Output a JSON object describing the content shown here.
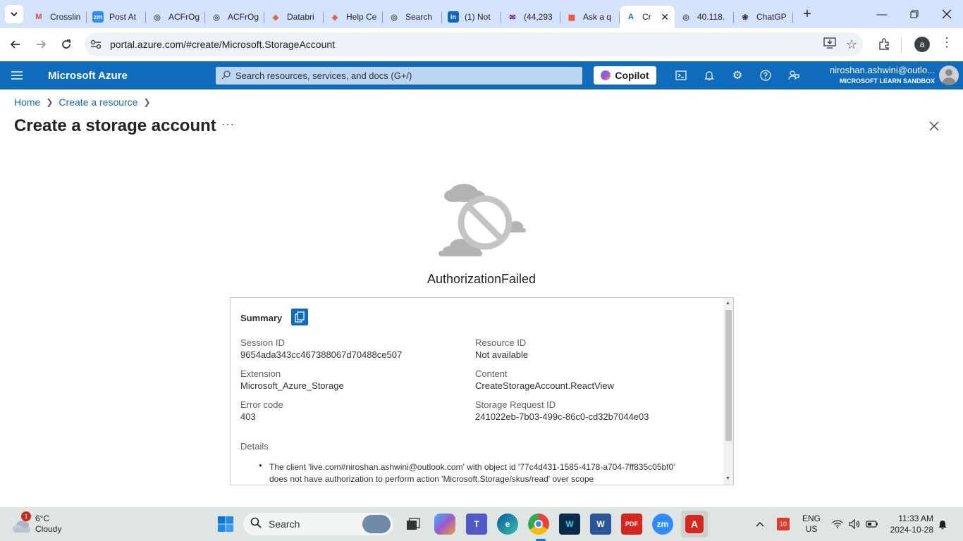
{
  "browser": {
    "tabs": [
      {
        "label": "Crosslin",
        "icon": "gmail-icon",
        "active": false
      },
      {
        "label": "Post At",
        "icon": "zoom-icon",
        "active": false
      },
      {
        "label": "ACFrOg",
        "icon": "globe-icon",
        "active": false
      },
      {
        "label": "ACFrOg",
        "icon": "globe-icon",
        "active": false
      },
      {
        "label": "Databri",
        "icon": "databricks-icon",
        "active": false
      },
      {
        "label": "Help Ce",
        "icon": "databricks-icon",
        "active": false
      },
      {
        "label": "Search",
        "icon": "globe-icon",
        "active": false
      },
      {
        "label": "(1) Not",
        "icon": "linkedin-icon",
        "active": false
      },
      {
        "label": "(44,293",
        "icon": "mail-icon",
        "active": false
      },
      {
        "label": "Ask a q",
        "icon": "microsoft-icon",
        "active": false
      },
      {
        "label": "Cr",
        "icon": "azure-icon",
        "active": true
      },
      {
        "label": "40.118.",
        "icon": "globe-icon",
        "active": false
      },
      {
        "label": "ChatGP",
        "icon": "chatgpt-icon",
        "active": false
      }
    ],
    "url": "portal.azure.com/#create/Microsoft.StorageAccount",
    "profile_initial": "a"
  },
  "azure": {
    "brand": "Microsoft Azure",
    "search_placeholder": "Search resources, services, and docs (G+/)",
    "copilot_label": "Copilot",
    "account_name": "niroshan.ashwini@outlo...",
    "account_org": "MICROSOFT LEARN SANDBOX"
  },
  "breadcrumb": [
    "Home",
    "Create a resource"
  ],
  "page_title": "Create a storage account",
  "page_more": "···",
  "error": {
    "title": "AuthorizationFailed",
    "summary_label": "Summary",
    "fields": {
      "session_id_label": "Session ID",
      "session_id": "9654ada343cc467388067d70488ce507",
      "resource_id_label": "Resource ID",
      "resource_id": "Not available",
      "extension_label": "Extension",
      "extension": "Microsoft_Azure_Storage",
      "content_label": "Content",
      "content": "CreateStorageAccount.ReactView",
      "error_code_label": "Error code",
      "error_code": "403",
      "storage_request_id_label": "Storage Request ID",
      "storage_request_id": "241022eb-7b03-499c-86c0-cd32b7044e03"
    },
    "details_label": "Details",
    "details_line1": "The client 'live.com#niroshan.ashwini@outlook.com' with object id '77c4d431-1585-4178-a704-7ff835c05bf0'",
    "details_line2": "does not have authorization to perform action 'Microsoft.Storage/skus/read' over scope"
  },
  "taskbar": {
    "weather_temp": "6°C",
    "weather_cond": "Cloudy",
    "weather_badge": "1",
    "search_label": "Search",
    "lang_top": "ENG",
    "lang_bottom": "US",
    "time": "11:33 AM",
    "date": "2024-10-28",
    "calendar_badge": "10"
  }
}
